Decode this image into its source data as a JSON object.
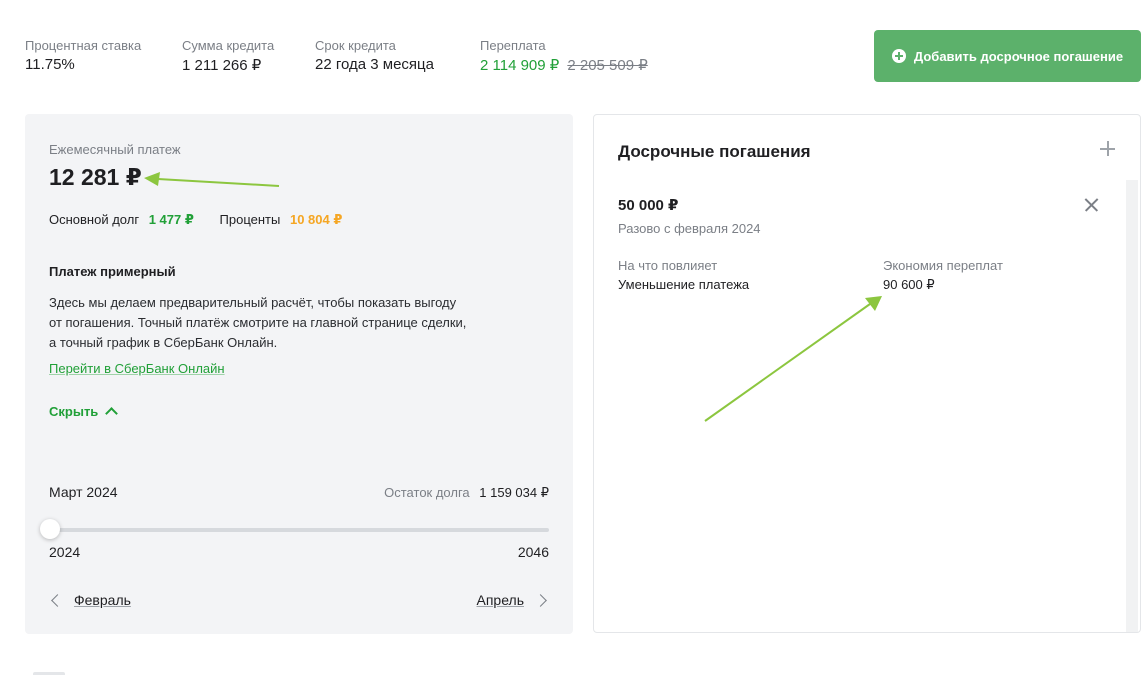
{
  "summary": {
    "rate": {
      "label": "Процентная ставка",
      "value": "11.75%"
    },
    "amount": {
      "label": "Сумма кредита",
      "value": "1 211 266 ₽"
    },
    "term": {
      "label": "Срок кредита",
      "value": "22 года 3 месяца"
    },
    "overpayment": {
      "label": "Переплата",
      "value": "2 114 909 ₽",
      "old_value": "2 205 509 ₽"
    }
  },
  "add_button": {
    "label": "Добавить досрочное погашение",
    "icon": "plus-circle-icon"
  },
  "payment": {
    "label": "Ежемесячный платеж",
    "amount": "12 281 ₽",
    "principal_label": "Основной долг",
    "principal_value": "1 477 ₽",
    "interest_label": "Проценты",
    "interest_value": "10 804 ₽",
    "note_title": "Платеж примерный",
    "note_lines": [
      "Здесь мы делаем предварительный расчёт, чтобы показать выгоду",
      "от погашения. Точный платёж смотрите на главной странице сделки,",
      "а точный график в СберБанк Онлайн."
    ],
    "online_link": "Перейти в СберБанк Онлайн",
    "hide_label": "Скрыть"
  },
  "timeline": {
    "month": "Март 2024",
    "remaining_label": "Остаток долга",
    "remaining_value": "1 159 034 ₽",
    "start_year": "2024",
    "end_year": "2046",
    "position": 0,
    "prev_label": "Февраль",
    "next_label": "Апрель"
  },
  "early_repayments": {
    "title": "Досрочные погашения",
    "item": {
      "amount": "50 000 ₽",
      "schedule": "Разово с февраля 2024",
      "effect_label": "На что повлияет",
      "effect_value": "Уменьшение платежа",
      "savings_label": "Экономия переплат",
      "savings_value": "90 600 ₽"
    }
  },
  "colors": {
    "accent_green": "#21a038",
    "button_green": "#5cb16b",
    "interest_orange": "#f5a623",
    "annotation_arrow": "#8cc63f"
  }
}
